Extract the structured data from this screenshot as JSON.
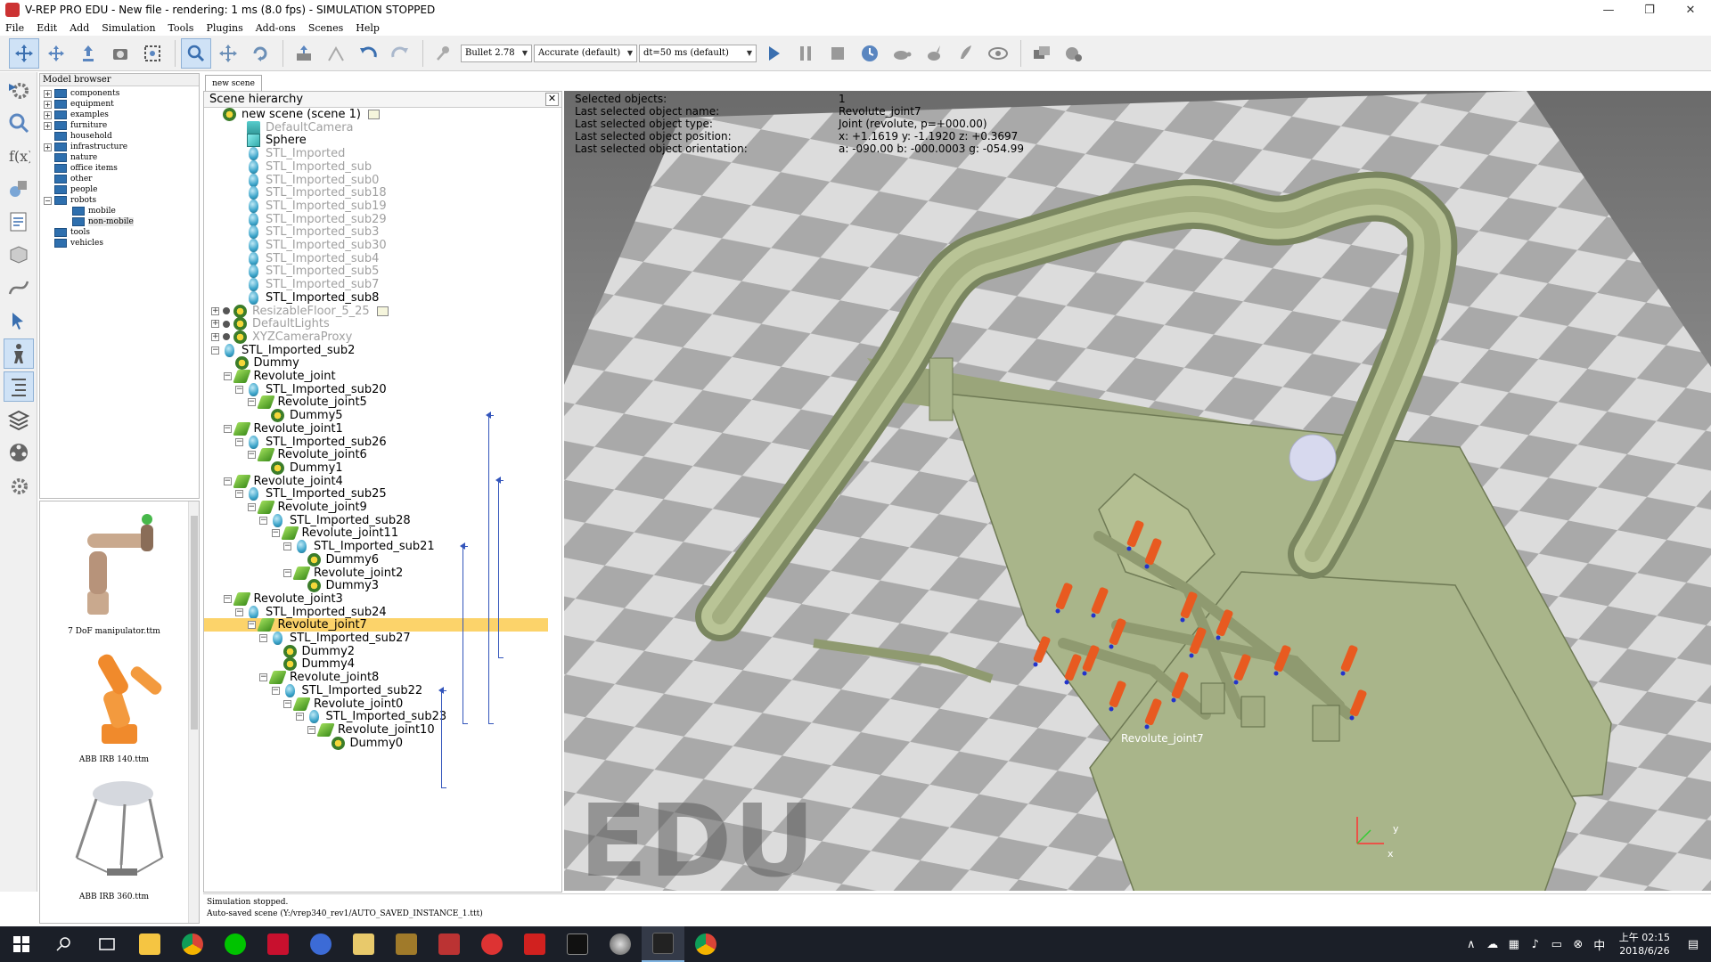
{
  "window": {
    "title": "V-REP PRO EDU - New file - rendering: 1 ms (8.0 fps) - SIMULATION STOPPED",
    "controls": [
      "—",
      "❐",
      "✕"
    ]
  },
  "menu": [
    "File",
    "Edit",
    "Add",
    "Simulation",
    "Tools",
    "Plugins",
    "Add-ons",
    "Scenes",
    "Help"
  ],
  "toolbar": {
    "engine": "Bullet 2.78",
    "accuracy": "Accurate (default)",
    "timestep": "dt=50 ms (default)"
  },
  "model_browser": {
    "title": "Model browser",
    "items": [
      {
        "label": "components",
        "expand": "+",
        "indent": 0
      },
      {
        "label": "equipment",
        "expand": "+",
        "indent": 0
      },
      {
        "label": "examples",
        "expand": "+",
        "indent": 0
      },
      {
        "label": "furniture",
        "expand": "+",
        "indent": 0
      },
      {
        "label": "household",
        "expand": "",
        "indent": 0
      },
      {
        "label": "infrastructure",
        "expand": "+",
        "indent": 0
      },
      {
        "label": "nature",
        "expand": "",
        "indent": 0
      },
      {
        "label": "office items",
        "expand": "",
        "indent": 0
      },
      {
        "label": "other",
        "expand": "",
        "indent": 0
      },
      {
        "label": "people",
        "expand": "",
        "indent": 0
      },
      {
        "label": "robots",
        "expand": "−",
        "indent": 0
      },
      {
        "label": "mobile",
        "expand": "",
        "indent": 1
      },
      {
        "label": "non-mobile",
        "expand": "",
        "indent": 1,
        "selected": true
      },
      {
        "label": "tools",
        "expand": "",
        "indent": 0
      },
      {
        "label": "vehicles",
        "expand": "",
        "indent": 0
      }
    ],
    "thumbnails": [
      "7 DoF manipulator.ttm",
      "ABB IRB 140.ttm",
      "ABB IRB 360.ttm"
    ]
  },
  "scene_tab": "new scene",
  "hierarchy": {
    "title": "Scene hierarchy",
    "close": "✕",
    "rows": [
      {
        "label": "new scene (scene 1)",
        "indent": 0,
        "icon": "model",
        "expand": "",
        "badge": true
      },
      {
        "label": "DefaultCamera",
        "indent": 2,
        "icon": "cam",
        "dim": true
      },
      {
        "label": "Sphere",
        "indent": 2,
        "icon": "cube"
      },
      {
        "label": "STL_Imported",
        "indent": 2,
        "icon": "shape",
        "dim": true
      },
      {
        "label": "STL_Imported_sub",
        "indent": 2,
        "icon": "shape",
        "dim": true
      },
      {
        "label": "STL_Imported_sub0",
        "indent": 2,
        "icon": "shape",
        "dim": true
      },
      {
        "label": "STL_Imported_sub18",
        "indent": 2,
        "icon": "shape",
        "dim": true
      },
      {
        "label": "STL_Imported_sub19",
        "indent": 2,
        "icon": "shape",
        "dim": true
      },
      {
        "label": "STL_Imported_sub29",
        "indent": 2,
        "icon": "shape",
        "dim": true
      },
      {
        "label": "STL_Imported_sub3",
        "indent": 2,
        "icon": "shape",
        "dim": true
      },
      {
        "label": "STL_Imported_sub30",
        "indent": 2,
        "icon": "shape",
        "dim": true
      },
      {
        "label": "STL_Imported_sub4",
        "indent": 2,
        "icon": "shape",
        "dim": true
      },
      {
        "label": "STL_Imported_sub5",
        "indent": 2,
        "icon": "shape",
        "dim": true
      },
      {
        "label": "STL_Imported_sub7",
        "indent": 2,
        "icon": "shape",
        "dim": true
      },
      {
        "label": "STL_Imported_sub8",
        "indent": 2,
        "icon": "shape"
      },
      {
        "label": "ResizableFloor_5_25",
        "indent": 0,
        "icon": "model",
        "expand": "+",
        "dot": true,
        "dim": true,
        "badge": true
      },
      {
        "label": "DefaultLights",
        "indent": 0,
        "icon": "model",
        "expand": "+",
        "dot": true,
        "dim": true
      },
      {
        "label": "XYZCameraProxy",
        "indent": 0,
        "icon": "model",
        "expand": "+",
        "dot": true,
        "dim": true
      },
      {
        "label": "STL_Imported_sub2",
        "indent": 0,
        "icon": "shape",
        "expand": "−"
      },
      {
        "label": "Dummy",
        "indent": 1,
        "icon": "dummy"
      },
      {
        "label": "Revolute_joint",
        "indent": 1,
        "icon": "joint",
        "expand": "−"
      },
      {
        "label": "STL_Imported_sub20",
        "indent": 2,
        "icon": "shape",
        "expand": "−"
      },
      {
        "label": "Revolute_joint5",
        "indent": 3,
        "icon": "joint",
        "expand": "−"
      },
      {
        "label": "Dummy5",
        "indent": 4,
        "icon": "dummy"
      },
      {
        "label": "Revolute_joint1",
        "indent": 1,
        "icon": "joint",
        "expand": "−"
      },
      {
        "label": "STL_Imported_sub26",
        "indent": 2,
        "icon": "shape",
        "expand": "−"
      },
      {
        "label": "Revolute_joint6",
        "indent": 3,
        "icon": "joint",
        "expand": "−"
      },
      {
        "label": "Dummy1",
        "indent": 4,
        "icon": "dummy"
      },
      {
        "label": "Revolute_joint4",
        "indent": 1,
        "icon": "joint",
        "expand": "−"
      },
      {
        "label": "STL_Imported_sub25",
        "indent": 2,
        "icon": "shape",
        "expand": "−"
      },
      {
        "label": "Revolute_joint9",
        "indent": 3,
        "icon": "joint",
        "expand": "−"
      },
      {
        "label": "STL_Imported_sub28",
        "indent": 4,
        "icon": "shape",
        "expand": "−"
      },
      {
        "label": "Revolute_joint11",
        "indent": 5,
        "icon": "joint",
        "expand": "−"
      },
      {
        "label": "STL_Imported_sub21",
        "indent": 6,
        "icon": "shape",
        "expand": "−"
      },
      {
        "label": "Dummy6",
        "indent": 7,
        "icon": "dummy"
      },
      {
        "label": "Revolute_joint2",
        "indent": 6,
        "icon": "joint",
        "expand": "−"
      },
      {
        "label": "Dummy3",
        "indent": 7,
        "icon": "dummy"
      },
      {
        "label": "Revolute_joint3",
        "indent": 1,
        "icon": "joint",
        "expand": "−"
      },
      {
        "label": "STL_Imported_sub24",
        "indent": 2,
        "icon": "shape",
        "expand": "−"
      },
      {
        "label": "Revolute_joint7",
        "indent": 3,
        "icon": "joint",
        "expand": "−",
        "selected": true
      },
      {
        "label": "STL_Imported_sub27",
        "indent": 4,
        "icon": "shape",
        "expand": "−"
      },
      {
        "label": "Dummy2",
        "indent": 5,
        "icon": "dummy"
      },
      {
        "label": "Dummy4",
        "indent": 5,
        "icon": "dummy"
      },
      {
        "label": "Revolute_joint8",
        "indent": 4,
        "icon": "joint",
        "expand": "−"
      },
      {
        "label": "STL_Imported_sub22",
        "indent": 5,
        "icon": "shape",
        "expand": "−"
      },
      {
        "label": "Revolute_joint0",
        "indent": 6,
        "icon": "joint",
        "expand": "−"
      },
      {
        "label": "STL_Imported_sub23",
        "indent": 7,
        "icon": "shape",
        "expand": "−"
      },
      {
        "label": "Revolute_joint10",
        "indent": 8,
        "icon": "joint",
        "expand": "−"
      },
      {
        "label": "Dummy0",
        "indent": 9,
        "icon": "dummy"
      }
    ]
  },
  "viewport": {
    "info": [
      {
        "key": "Selected objects:",
        "value": "1"
      },
      {
        "key": "Last selected object name:",
        "value": "Revolute_joint7"
      },
      {
        "key": "Last selected object type:",
        "value": "Joint (revolute, p=+000.00)"
      },
      {
        "key": "Last selected object position:",
        "value": "x: +1.1619    y: -1.1920    z: +0.3697"
      },
      {
        "key": "Last selected object orientation:",
        "value": "a: -090.00    b: -000.0003    g: -054.99"
      }
    ],
    "object_label": "Revolute_joint7",
    "watermark": "EDU",
    "axis_labels": {
      "y": "y",
      "x": "x"
    }
  },
  "status": {
    "line1": "Simulation stopped.",
    "line2": "Auto-saved scene (Y:/vrep340_rev1/AUTO_SAVED_INSTANCE_1.ttt)"
  },
  "taskbar": {
    "time": "上午 02:15",
    "date": "2018/6/26",
    "ime": "中"
  },
  "colors": {
    "selection": "#fcd36a",
    "track": "#b5c48f",
    "floor_light": "#dcdcdc",
    "floor_dark": "#a9a9a9",
    "actuator": "#e85a20"
  }
}
